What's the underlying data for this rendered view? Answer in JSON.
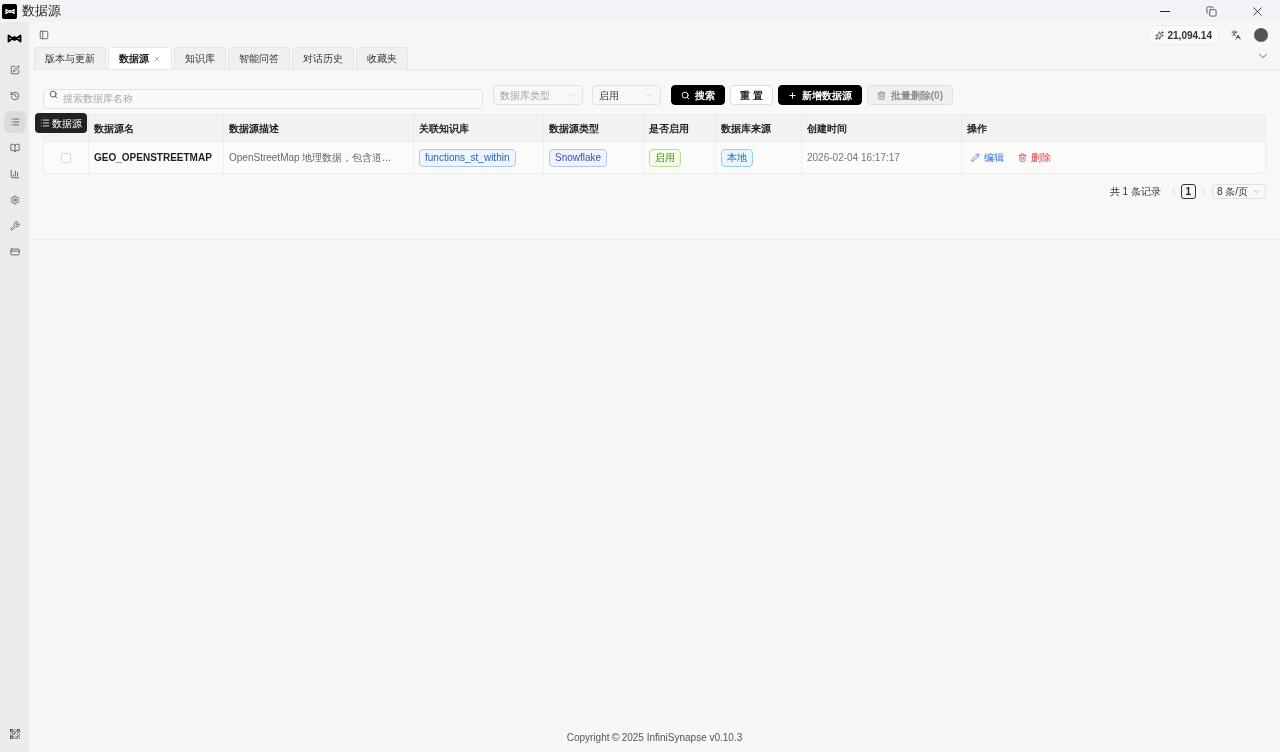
{
  "window": {
    "title": "数据源"
  },
  "sidebar": {
    "items": [
      {
        "selected": false
      },
      {
        "selected": false
      },
      {
        "selected": true
      },
      {
        "selected": false
      },
      {
        "selected": false
      },
      {
        "selected": false
      },
      {
        "selected": false
      },
      {
        "selected": false
      }
    ],
    "tooltip": "数据源"
  },
  "header": {
    "credits": "21,094.14"
  },
  "tabs": [
    {
      "label": "版本与更新",
      "selected": false,
      "closable": false
    },
    {
      "label": "数据源",
      "selected": true,
      "closable": true
    },
    {
      "label": "知识库",
      "selected": false,
      "closable": false
    },
    {
      "label": "智能问答",
      "selected": false,
      "closable": false
    },
    {
      "label": "对话历史",
      "selected": false,
      "closable": false
    },
    {
      "label": "收藏夹",
      "selected": false,
      "closable": false
    }
  ],
  "filters": {
    "search": {
      "placeholder": "搜索数据库名称"
    },
    "db_type": {
      "placeholder": "数据库类型"
    },
    "status": {
      "value": "启用"
    },
    "buttons": [
      {
        "label": "搜索",
        "kind": "primary",
        "disabled": false
      },
      {
        "label": "重 置",
        "kind": "default",
        "disabled": false
      },
      {
        "label": "新增数据源",
        "kind": "primary",
        "disabled": false
      },
      {
        "label": "批量删除(0)",
        "kind": "default",
        "disabled": true
      }
    ]
  },
  "table": {
    "columns": [
      "数据源名",
      "数据源描述",
      "关联知识库",
      "数据源类型",
      "是否启用",
      "数据库来源",
      "创建时间",
      "操作"
    ],
    "rows": [
      {
        "checked": false,
        "name": "GEO_OPENSTREETMAP",
        "description": "OpenStreetMap 地理数据，包含道...",
        "knowledge_base": "functions_st_within",
        "type": "Snowflake",
        "enabled": "启用",
        "source": "本地",
        "created": "2026-02-04 16:17:17",
        "actions": [
          {
            "label": "编辑",
            "kind": "edit"
          },
          {
            "label": "删除",
            "kind": "delete"
          }
        ]
      }
    ]
  },
  "pagination": {
    "total": "共 1 条记录",
    "pages": [
      {
        "label": "1",
        "selected": true
      }
    ],
    "page_size": "8 条/页"
  },
  "footer": {
    "copyright": "Copyright",
    "symbol": "©",
    "text": "2025 InfiniSynapse v0.10.3"
  }
}
